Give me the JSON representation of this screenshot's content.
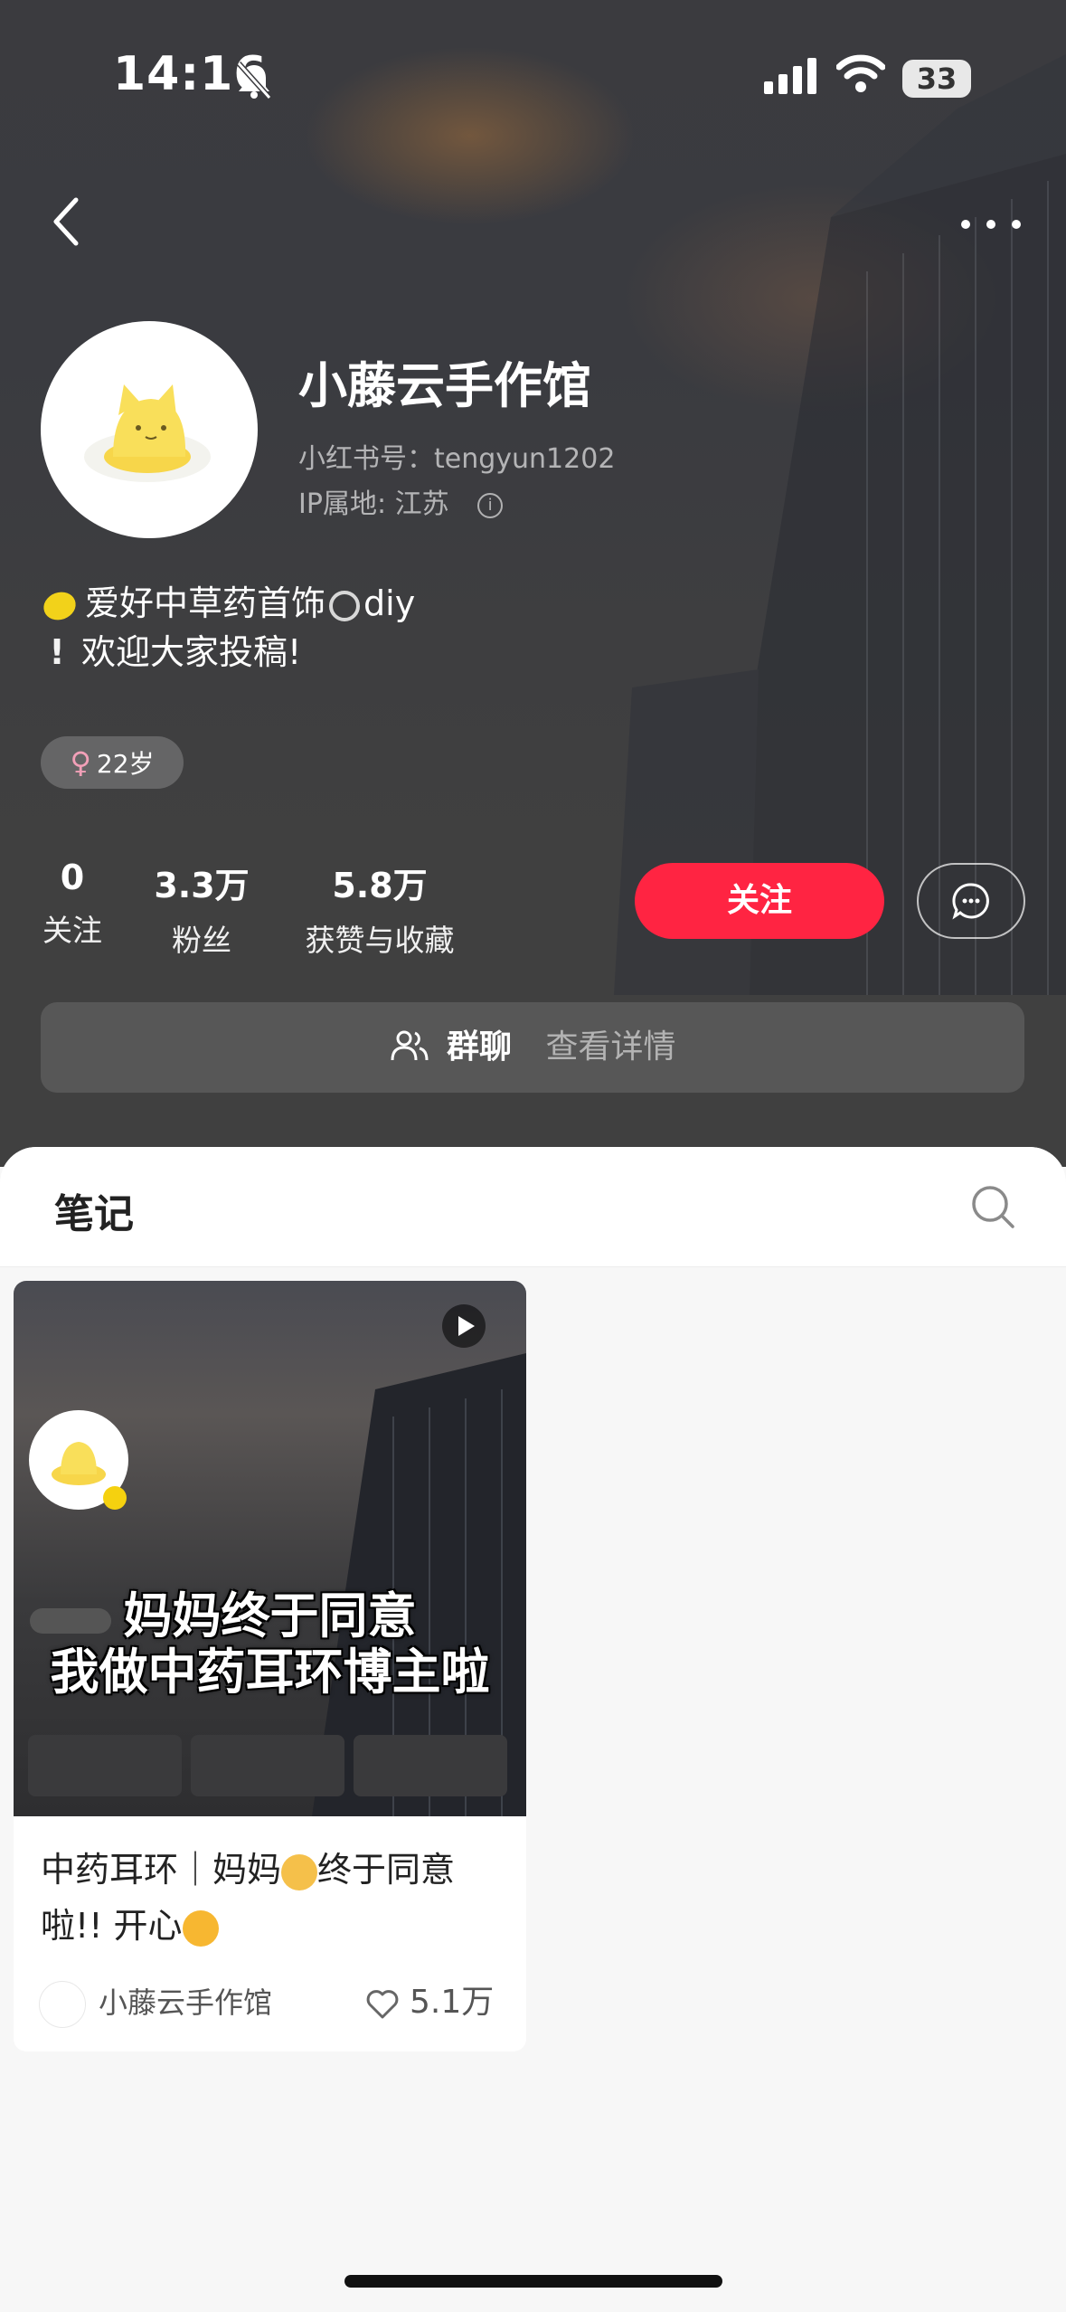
{
  "status_bar": {
    "time": "14:16",
    "battery": "33"
  },
  "profile": {
    "name": "小藤云手作馆",
    "redbook_id": "小红书号：tengyun1202",
    "ip": "IP属地: 江苏",
    "bio_line1": "爱好中草药首饰",
    "bio_line1_tail": "diy",
    "bio_line2": "欢迎大家投稿!",
    "age_tag": "22岁",
    "stats": [
      {
        "value": "0",
        "label": "关注"
      },
      {
        "value": "3.3万",
        "label": "粉丝"
      },
      {
        "value": "5.8万",
        "label": "获赞与收藏"
      }
    ],
    "follow_label": "关注",
    "group_chat_label": "群聊",
    "group_chat_detail": "查看详情"
  },
  "notes_tab": {
    "title": "笔记"
  },
  "note_card": {
    "overlay_line1": "妈妈终于同意",
    "overlay_line2": "我做中药耳环博主啦",
    "title_part1": "中药耳环｜妈妈",
    "title_part2": "终于同意啦!! 开心",
    "author": "小藤云手作馆",
    "likes": "5.1万"
  },
  "colors": {
    "accent": "#ff2442",
    "hero_bg": "#3e3e40"
  }
}
